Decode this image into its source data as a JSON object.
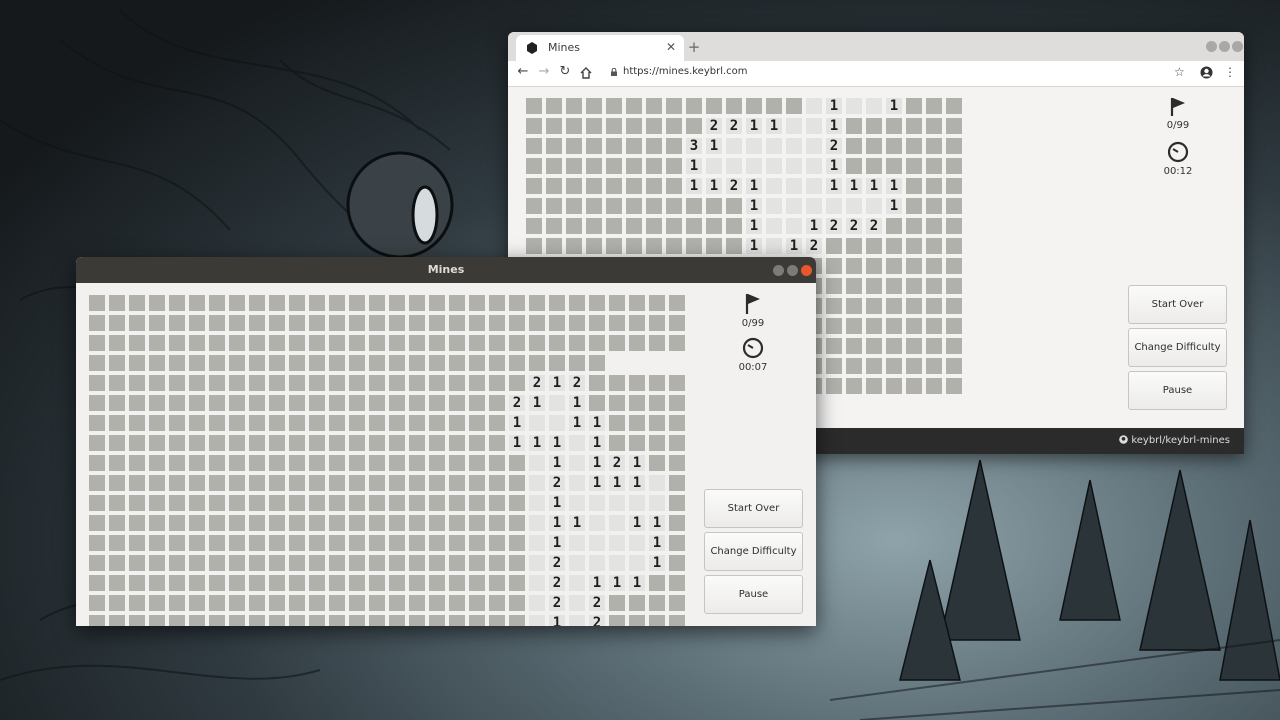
{
  "colors": {
    "cell_hidden": "#b1b1ac",
    "cell_open": "#e3e3e1",
    "app_bg": "#f2f1f0",
    "titlebar": "#3b3a37",
    "close_button": "#e8572b"
  },
  "browser": {
    "tab_title": "Mines",
    "new_tab": "+",
    "url": "https://mines.keybrl.com",
    "flag_counter": "0/99",
    "timer": "00:12",
    "buttons": {
      "start_over": "Start Over",
      "change_difficulty": "Change Difficulty",
      "pause": "Pause"
    },
    "footer_link": "keybrl/keybrl-mines",
    "grid_rows": [
      "..............X1XX1...",
      ".........2211XX1......",
      "........31XXXXX2......",
      "........1XXXXXX1......",
      "........1121XXX1111...",
      "...........1XXXXXX1...",
      "...........1XX1222....",
      "...........1X12.......",
      "...........2X1........",
      "...........2X1........",
      "...........223........",
      "......................",
      "......................",
      "......................",
      "......................"
    ]
  },
  "app": {
    "title": "Mines",
    "flag_counter": "0/99",
    "timer": "00:07",
    "buttons": {
      "start_over": "Start Over",
      "change_difficulty": "Change Difficulty",
      "pause": "Pause"
    },
    "grid_rows": [
      "..............................",
      "..............................",
      "..............................",
      "..........................",
      "......................212.....",
      ".....................21X1.....",
      ".....................1XX11....",
      ".....................111X1....",
      "......................X1X121..",
      "......................X2X111X.",
      "......................X1XXXXX.",
      "......................X11XX11.",
      "......................X1XXXX1.",
      "......................X2XXXX1.",
      "......................X2X111..",
      "......................X2X2....",
      "......................X1X2...."
    ]
  }
}
